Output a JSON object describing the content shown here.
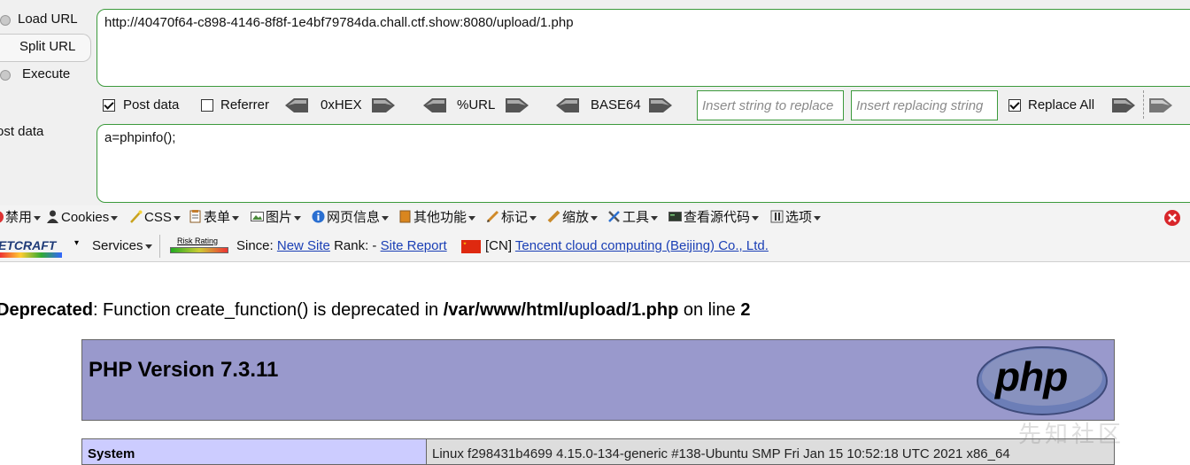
{
  "hackbar": {
    "load_url": "Load URL",
    "split_url": "Split URL",
    "execute": "Execute",
    "url_value": "http://40470f64-c898-4146-8f8f-1e4bf79784da.chall.ctf.show:8080/upload/1.php",
    "post_data_label": "ost data",
    "post_data_value": "a=phpinfo();",
    "options": {
      "post_data": "Post data",
      "post_data_checked": true,
      "referrer": "Referrer",
      "referrer_checked": false,
      "hex": "0xHEX",
      "url": "%URL",
      "base64": "BASE64",
      "insert_placeholder": "Insert string to replace",
      "replacing_placeholder": "Insert replacing string",
      "replace_all": "Replace All",
      "replace_all_checked": true
    }
  },
  "toolbar1": {
    "items": [
      "禁用",
      "Cookies",
      "CSS",
      "表单",
      "图片",
      "网页信息",
      "其他功能",
      "标记",
      "缩放",
      "工具",
      "查看源代码",
      "选项"
    ]
  },
  "toolbar2": {
    "netcraft_logo": "ETCRAFT",
    "services": "Services",
    "risk_rating": "Risk Rating",
    "since_label": "Since:",
    "since_link": "New Site",
    "rank_label": "Rank: -",
    "site_report": "Site Report",
    "country": "[CN]",
    "hosting": "Tencent cloud computing (Beijing) Co., Ltd."
  },
  "content": {
    "deprecated_label": "Deprecated",
    "deprecated_msg": ": Function create_function() is deprecated in ",
    "deprecated_path": "/var/www/html/upload/1.php",
    "deprecated_on_line": " on line ",
    "deprecated_line": "2",
    "php_version": "PHP Version 7.3.11",
    "php_logo": "php",
    "system_label": "System",
    "system_value": "Linux f298431b4699 4.15.0-134-generic #138-Ubuntu SMP Fri Jan 15 10:52:18 UTC 2021 x86_64",
    "watermark": "先知社区"
  },
  "colors": {
    "php_header_bg": "#9999cc",
    "system_label_bg": "#ccccff",
    "system_value_bg": "#dddddd",
    "input_border": "#3c9a3c",
    "link": "#1a3fb5"
  }
}
